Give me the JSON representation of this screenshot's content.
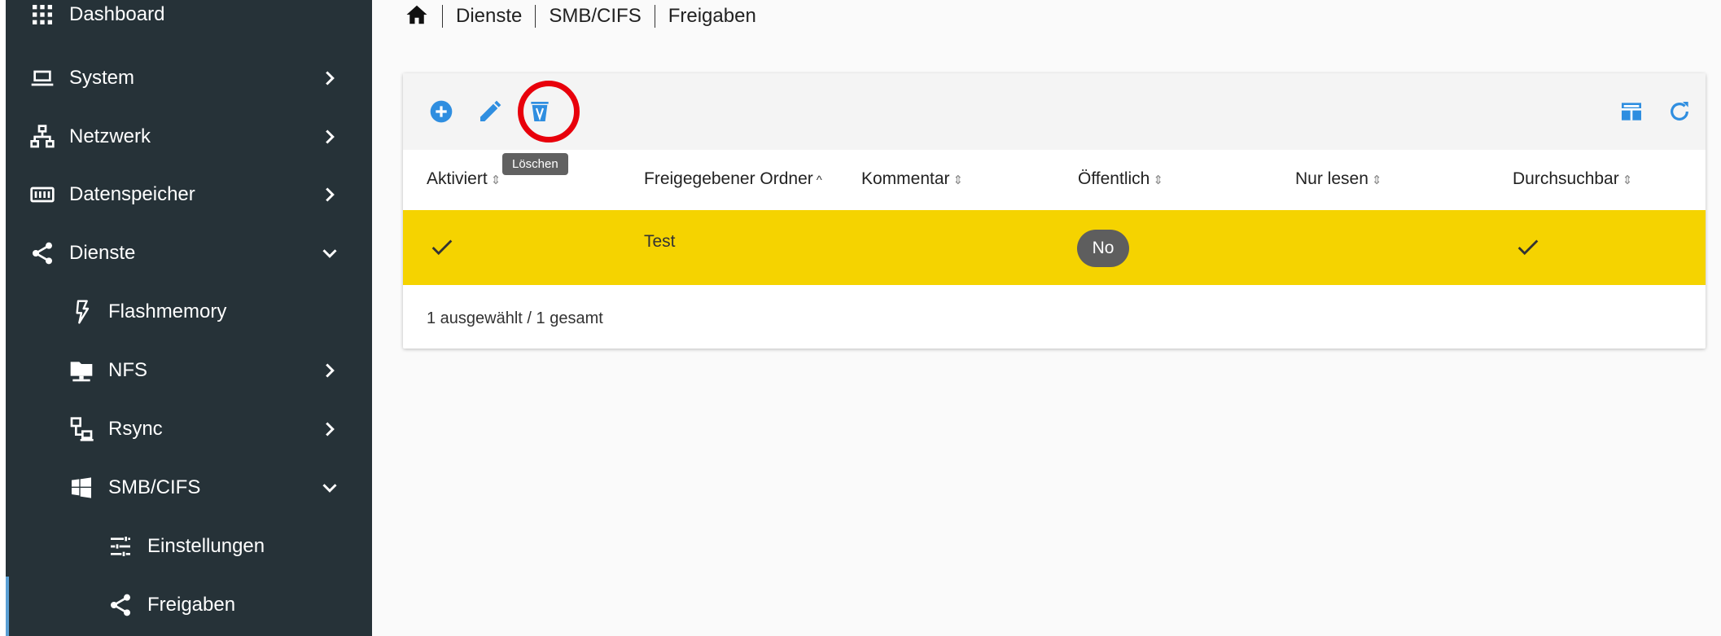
{
  "sidebar": {
    "items": [
      {
        "label": "Dashboard",
        "icon": "grid-icon"
      },
      {
        "label": "System",
        "icon": "laptop-icon"
      },
      {
        "label": "Netzwerk",
        "icon": "network-icon"
      },
      {
        "label": "Datenspeicher",
        "icon": "storage-icon"
      },
      {
        "label": "Dienste",
        "icon": "share-icon"
      },
      {
        "label": "Flashmemory",
        "icon": "flash-icon"
      },
      {
        "label": "NFS",
        "icon": "nfs-icon"
      },
      {
        "label": "Rsync",
        "icon": "rsync-icon"
      },
      {
        "label": "SMB/CIFS",
        "icon": "windows-icon"
      },
      {
        "label": "Einstellungen",
        "icon": "tune-icon"
      },
      {
        "label": "Freigaben",
        "icon": "share-icon"
      }
    ]
  },
  "breadcrumb": [
    "Dienste",
    "SMB/CIFS",
    "Freigaben"
  ],
  "toolbar": {
    "tooltip": "Löschen"
  },
  "table": {
    "columns": [
      "Aktiviert",
      "Freigegebener Ordner",
      "Kommentar",
      "Öffentlich",
      "Nur lesen",
      "Durchsuchbar"
    ],
    "rows": [
      {
        "aktiviert": true,
        "ordner": "Test",
        "kommentar": "",
        "oeffentlich": "No",
        "nur_lesen": false,
        "durchsuchbar": true
      }
    ],
    "footer": "1 ausgewählt / 1 gesamt"
  },
  "colors": {
    "sidebar_bg": "#263238",
    "accent": "#2196f3",
    "selected_row": "#f5d300",
    "highlight_ring": "#e8000b"
  }
}
